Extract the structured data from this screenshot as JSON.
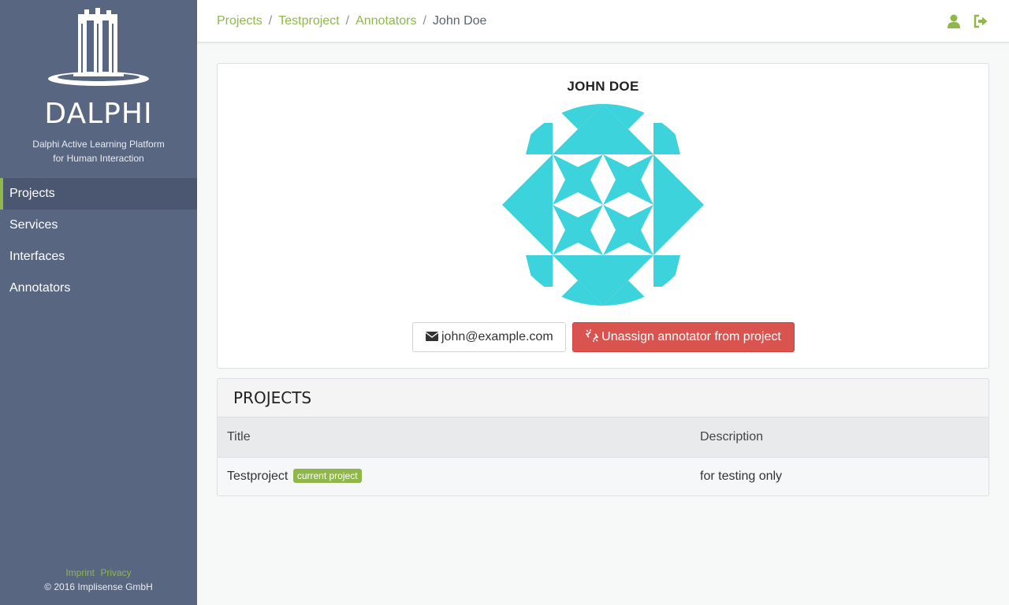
{
  "sidebar": {
    "brand": "DALPHI",
    "tagline_line1": "Dalphi Active Learning Platform",
    "tagline_line2": "for Human Interaction",
    "items": [
      {
        "label": "Projects",
        "active": true
      },
      {
        "label": "Services",
        "active": false
      },
      {
        "label": "Interfaces",
        "active": false
      },
      {
        "label": "Annotators",
        "active": false
      }
    ],
    "footer": {
      "imprint": "Imprint",
      "privacy": "Privacy",
      "copyright": "© 2016 Implisense GmbH"
    }
  },
  "header": {
    "breadcrumb": [
      "Projects",
      "Testproject",
      "Annotators"
    ],
    "current": "John Doe",
    "separator": "/",
    "icons": [
      "user-icon",
      "sign-out-icon"
    ]
  },
  "profile": {
    "name": "JOHN DOE",
    "email": "john@example.com",
    "unassign_label": "Unassign annotator from project",
    "avatar_color": "#3dd3dc"
  },
  "projects_panel": {
    "title": "PROJECTS",
    "columns": [
      "Title",
      "Description"
    ],
    "rows": [
      {
        "title": "Testproject",
        "badge": "current project",
        "description": "for testing only"
      }
    ]
  },
  "colors": {
    "sidebar_bg": "#596681",
    "accent_green": "#8fb74b",
    "danger_red": "#d9534f"
  }
}
